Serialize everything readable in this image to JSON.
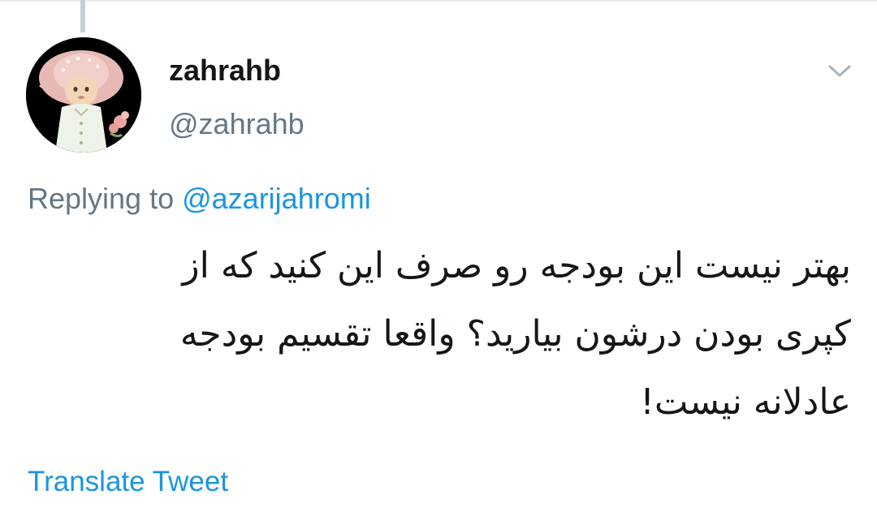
{
  "tweet": {
    "author": {
      "display_name": "zahrahb",
      "handle": "@zahrahb",
      "avatar_icon": "doll-avatar"
    },
    "menu_icon": "chevron-down-icon",
    "reply": {
      "prefix": "Replying to ",
      "mention": "@azarijahromi"
    },
    "text_lines": [
      "بهتر نیست این بودجه رو صرف این کنید که از",
      "کپری بودن درشون بیارید؟ واقعا تقسیم بودجه",
      "عادلانه نیست!"
    ],
    "translate_label": "Translate Tweet"
  },
  "colors": {
    "text_primary": "#14171a",
    "text_secondary": "#657786",
    "link": "#1b95e0",
    "thread_line": "#c4cfd6",
    "border": "#e6ecf0"
  }
}
